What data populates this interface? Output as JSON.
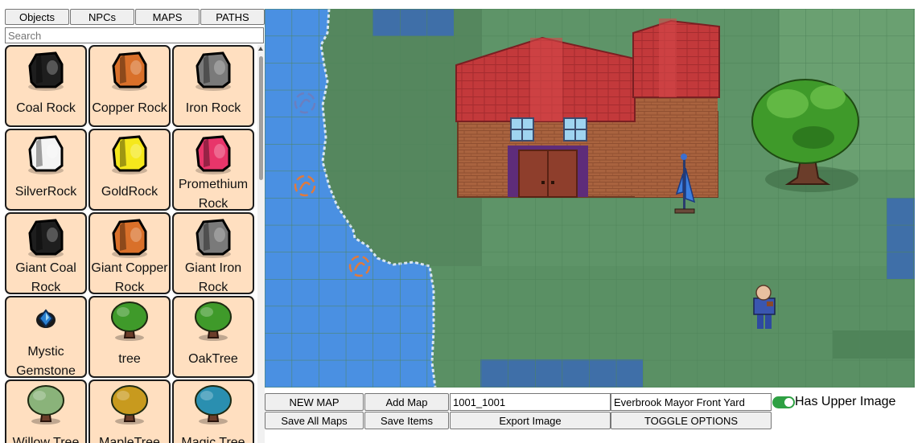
{
  "tabs": [
    "Objects",
    "NPCs",
    "MAPS",
    "PATHS"
  ],
  "search": {
    "placeholder": "Search"
  },
  "objects": [
    {
      "label": "Coal Rock",
      "icon": "coal-rock-icon",
      "color": "#1e1e1e"
    },
    {
      "label": "Copper Rock",
      "icon": "copper-rock-icon",
      "color": "#d9702a"
    },
    {
      "label": "Iron Rock",
      "icon": "iron-rock-icon",
      "color": "#7a7a7a"
    },
    {
      "label": "SilverRock",
      "icon": "silver-rock-icon",
      "color": "#f4f4f4"
    },
    {
      "label": "GoldRock",
      "icon": "gold-rock-icon",
      "color": "#f5e81c"
    },
    {
      "label": "Promethium Rock",
      "icon": "promethium-rock-icon",
      "color": "#e8356a"
    },
    {
      "label": "Giant Coal Rock",
      "icon": "giant-coal-rock-icon",
      "color": "#1e1e1e"
    },
    {
      "label": "Giant Copper Rock",
      "icon": "giant-copper-rock-icon",
      "color": "#d9702a"
    },
    {
      "label": "Giant Iron Rock",
      "icon": "giant-iron-rock-icon",
      "color": "#7a7a7a"
    },
    {
      "label": "Mystic Gemstone Rock",
      "icon": "gemstone-icon",
      "color": "#2a7fd0"
    },
    {
      "label": "tree",
      "icon": "tree-icon",
      "color": "#3f9a2a"
    },
    {
      "label": "OakTree",
      "icon": "oak-tree-icon",
      "color": "#3f9a2a"
    },
    {
      "label": "Willow Tree",
      "icon": "willow-tree-icon",
      "color": "#8ab37a"
    },
    {
      "label": "MapleTree",
      "icon": "maple-tree-icon",
      "color": "#c89a1e"
    },
    {
      "label": "Magic Tree",
      "icon": "magic-tree-icon",
      "color": "#2a8fb0"
    }
  ],
  "controls": {
    "new_map": "NEW MAP",
    "add_map": "Add Map",
    "map_id": "1001_1001",
    "map_name": "Everbrook Mayor Front Yard",
    "upper_image_label": "Has Upper Image",
    "upper_image_on": true,
    "save_all_maps": "Save All Maps",
    "save_items": "Save Items",
    "export_image": "Export Image",
    "toggle_options": "TOGGLE OPTIONS"
  },
  "colors": {
    "card_bg": "#ffdfc0",
    "grass": "#5e9468",
    "water": "#4a90e2",
    "roof": "#c0393c",
    "toggle": "#2ea043"
  }
}
